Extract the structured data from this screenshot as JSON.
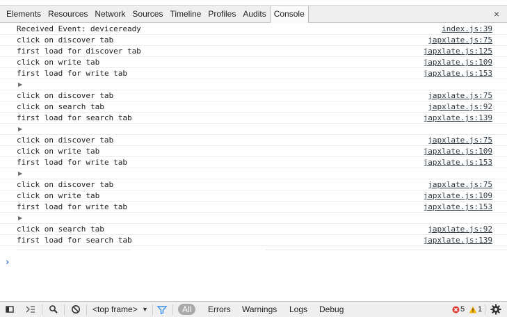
{
  "tabs": [
    {
      "label": "Elements"
    },
    {
      "label": "Resources"
    },
    {
      "label": "Network"
    },
    {
      "label": "Sources"
    },
    {
      "label": "Timeline"
    },
    {
      "label": "Profiles"
    },
    {
      "label": "Audits"
    },
    {
      "label": "Console",
      "selected": true
    }
  ],
  "close_label": "×",
  "console": {
    "rows": [
      {
        "message": "Received Event: deviceready",
        "source": "index.js:39"
      },
      {
        "message": "click on discover tab",
        "source": "japxlate.js:75"
      },
      {
        "message": "first load for discover tab",
        "source": "japxlate.js:125"
      },
      {
        "message": "click on write tab",
        "source": "japxlate.js:109"
      },
      {
        "message": "first load for write tab",
        "source": "japxlate.js:153"
      },
      {
        "group_arrow": "▶"
      },
      {
        "message": "click on discover tab",
        "source": "japxlate.js:75"
      },
      {
        "message": "click on search tab",
        "source": "japxlate.js:92"
      },
      {
        "message": "first load for search tab",
        "source": "japxlate.js:139"
      },
      {
        "group_arrow": "▶"
      },
      {
        "message": "click on discover tab",
        "source": "japxlate.js:75"
      },
      {
        "message": "click on write tab",
        "source": "japxlate.js:109"
      },
      {
        "message": "first load for write tab",
        "source": "japxlate.js:153"
      },
      {
        "group_arrow": "▶"
      },
      {
        "message": "click on discover tab",
        "source": "japxlate.js:75"
      },
      {
        "message": "click on write tab",
        "source": "japxlate.js:109"
      },
      {
        "message": "first load for write tab",
        "source": "japxlate.js:153"
      },
      {
        "group_arrow": "▶"
      },
      {
        "message": "click on search tab",
        "source": "japxlate.js:92"
      },
      {
        "message": "first load for search tab",
        "source": "japxlate.js:139"
      }
    ],
    "prompt_symbol": "›"
  },
  "bottombar": {
    "frame_select": "<top frame>",
    "frame_arrow": "▼",
    "filters": {
      "all": "All",
      "errors": "Errors",
      "warnings": "Warnings",
      "logs": "Logs",
      "debug": "Debug"
    },
    "error_count": "5",
    "warning_count": "1"
  },
  "colors": {
    "toolbar_bg": "#efefef",
    "link": "#303942",
    "prompt": "#3f7ed9",
    "error": "#e53935",
    "warning": "#f2b600",
    "filter_icon": "#3a8ee6"
  },
  "icons": {
    "dock": "dock-side-icon",
    "drawer": "show-drawer-icon",
    "search": "search-icon",
    "clear": "clear-console-icon",
    "filter": "filter-icon",
    "error": "error-icon",
    "warning": "warning-icon",
    "settings": "gear-icon"
  }
}
